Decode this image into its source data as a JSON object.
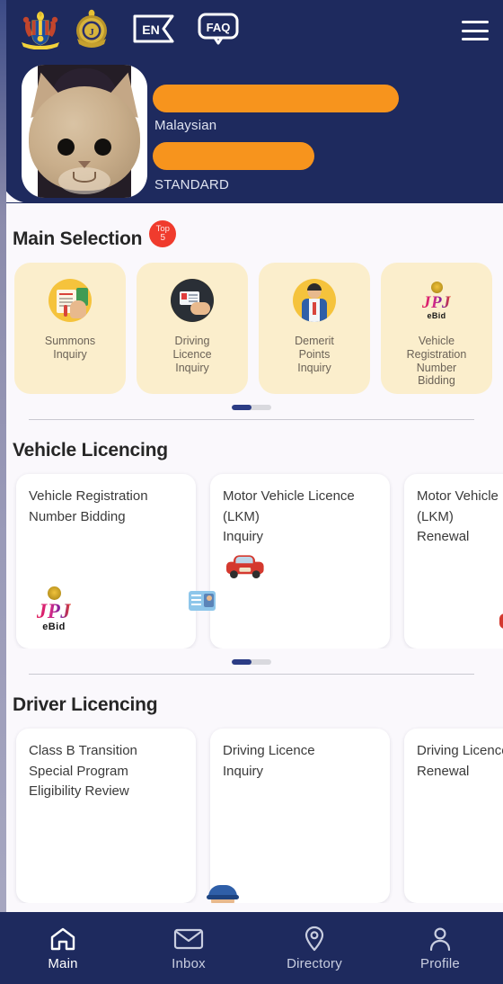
{
  "header": {
    "emblems": [
      {
        "name": "malaysia-coat-of-arms",
        "label": "Jata Negara"
      },
      {
        "name": "jpj-emblem",
        "label": "JPJ"
      }
    ],
    "language_button": "EN",
    "faq_button": "FAQ",
    "menu_button": "menu",
    "colors": {
      "navy": "#1e2a5e",
      "orange_redaction": "#f7941d",
      "badge_red": "#f03b2d",
      "card_cream": "#fbeecc",
      "icon_yellow": "#f5c33c"
    }
  },
  "profile": {
    "avatar": "user-photo-cat",
    "name_redacted": true,
    "id_redacted": true,
    "nationality": "Malaysian",
    "account_type": "STANDARD"
  },
  "main_selection": {
    "title": "Main Selection",
    "badge": {
      "top_label": "Top",
      "count": "5"
    },
    "items": [
      {
        "label": "Summons\nInquiry",
        "icon": "summons-icon"
      },
      {
        "label": "Driving\nLicence\nInquiry",
        "icon": "driving-licence-icon"
      },
      {
        "label": "Demerit\nPoints\nInquiry",
        "icon": "demerit-points-icon"
      },
      {
        "label": "Vehicle\nRegistration\nNumber\nBidding",
        "icon": "jpj-ebid-logo"
      }
    ],
    "pager": {
      "position": 1,
      "total": 2
    }
  },
  "vehicle_licencing": {
    "title": "Vehicle Licencing",
    "items": [
      {
        "label": "Vehicle Registration\nNumber Bidding",
        "icon": "jpj-ebid-logo"
      },
      {
        "label": "Motor Vehicle Licence\n(LKM)\nInquiry",
        "icon": "licence-car-icon"
      },
      {
        "label": "Motor Vehicle Licence\n(LKM)\nRenewal",
        "icon": "car-licence-renewal-icon"
      }
    ],
    "pager": {
      "position": 1,
      "total": 2
    }
  },
  "driver_licencing": {
    "title": "Driver Licencing",
    "items": [
      {
        "label": "Class B Transition\nSpecial Program\nEligibility Review",
        "icon": "class-b-icon"
      },
      {
        "label": "Driving Licence\nInquiry",
        "icon": "driving-licence-inquiry-icon"
      },
      {
        "label": "Driving Licence\nRenewal",
        "icon": "green-check-icon"
      }
    ]
  },
  "bottom_nav": {
    "items": [
      {
        "label": "Main",
        "icon": "home-icon",
        "active": true
      },
      {
        "label": "Inbox",
        "icon": "envelope-icon",
        "active": false
      },
      {
        "label": "Directory",
        "icon": "location-pin-icon",
        "active": false
      },
      {
        "label": "Profile",
        "icon": "person-icon",
        "active": false
      }
    ]
  },
  "jpj_logo": {
    "word": "JPJ",
    "sub": "eBid"
  }
}
